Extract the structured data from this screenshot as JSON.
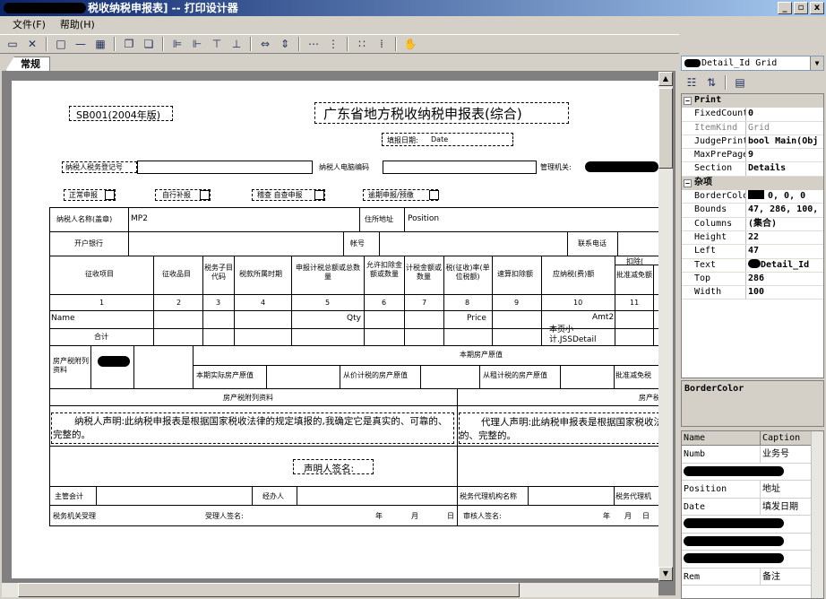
{
  "window": {
    "title_suffix": "税收纳税申报表] -- 打印设计器",
    "buttons": [
      "_",
      "▫",
      "x"
    ]
  },
  "menu": [
    "文件(F)",
    "帮助(H)"
  ],
  "tab": "常规",
  "report": {
    "code": "SB001(2004年版)",
    "title": "广东省地方税收纳税申报表(综合)",
    "fill_date_label": "填报日期:",
    "fill_date_field": "Date",
    "taxpayer_reg_label": "纳税人税务登记号",
    "taxpayer_pc_label": "纳税人电脑编码",
    "authority_label": "管理机关:",
    "check_normal": "正常申报",
    "check_self": "自行补报",
    "check_inspect": "稽查 自查申报",
    "check_late": "逾期申报/预缴",
    "name_label": "纳税人名称(盖章)",
    "name_field": "MP2",
    "address_label": "住所地址",
    "address_field": "Position",
    "bank_label": "开户银行",
    "account_label": "帐号",
    "phone_label": "联系电话",
    "col_headers": [
      "征收项目",
      "征收品目",
      "税务子目代码",
      "税款所属时期",
      "申报计税总额或总数量",
      "允许扣除金额或数量",
      "计税金额或数量",
      "税(征收)率(单位税额)",
      "速算扣除额",
      "应纳税(费)额",
      "扣除(",
      "批准减免额"
    ],
    "col_numbers": [
      "1",
      "2",
      "3",
      "4",
      "5",
      "6",
      "7",
      "8",
      "9",
      "10",
      "11"
    ],
    "detail_row": {
      "name": "Name",
      "qty": "Qty",
      "price": "Price",
      "amt": "Amt2"
    },
    "total_label": "合计",
    "page_subtotal": "本页小计.JSSDetail",
    "property_label": "房产税附列资料",
    "property_original": "本期房产原值",
    "property_actual": "本期实际房产原值",
    "property_price": "从价计税的房产原值",
    "property_rent": "从租计税的房产原值",
    "property_exempt": "批准减免税",
    "property_attach": "房产税附列资料",
    "property_attach2": "房产税",
    "declaration": "纳税人声明:此纳税申报表是根据国家税收法律的规定填报的,我确定它是真实的、可靠的、完整的。",
    "agent_declaration": "代理人声明:此纳税申报表是根据国家税收法",
    "agent_decl2": "的、完整的。",
    "signature_label": "声明人签名:",
    "accountant_label": "主管会计",
    "handler_label": "经办人",
    "agent_org_label": "税务代理机构名称",
    "agent_org2": "税务代理机",
    "received_by": "税务机关受理",
    "receiver_sign": "受理人签名:",
    "year": "年",
    "month": "月",
    "day": "日",
    "reviewer_sign": "审核人签名:"
  },
  "properties": {
    "object": "Detail_Id Grid",
    "rows": [
      {
        "type": "cat",
        "label": "Print"
      },
      {
        "key": "FixedCount",
        "value": "0"
      },
      {
        "key": "ItemKind",
        "value": "Grid",
        "disabled": true
      },
      {
        "key": "JudgePrint",
        "value": "bool Main(Obj"
      },
      {
        "key": "MaxPrePage",
        "value": "9"
      },
      {
        "key": "Section",
        "value": "Details"
      },
      {
        "type": "cat",
        "label": "杂项"
      },
      {
        "key": "BorderColo",
        "value": "0, 0, 0"
      },
      {
        "key": "Bounds",
        "value": "47, 286, 100,"
      },
      {
        "key": "Columns",
        "value": "(集合)"
      },
      {
        "key": "Height",
        "value": "22"
      },
      {
        "key": "Left",
        "value": "47"
      },
      {
        "key": "Text",
        "value": "Detail_Id"
      },
      {
        "key": "Top",
        "value": "286"
      },
      {
        "key": "Width",
        "value": "100"
      }
    ],
    "description": "BorderColor"
  },
  "fields": {
    "headers": [
      "Name",
      "Caption"
    ],
    "rows": [
      {
        "name": "Numb",
        "caption": "业务号"
      },
      {
        "name": "",
        "caption": "",
        "redacted": true
      },
      {
        "name": "Position",
        "caption": "地址"
      },
      {
        "name": "Date",
        "caption": "填发日期"
      },
      {
        "name": "",
        "caption": "",
        "redacted": true
      },
      {
        "name": "",
        "caption": "",
        "redacted": true
      },
      {
        "name": "",
        "caption": "",
        "redacted": true
      },
      {
        "name": "Rem",
        "caption": "备注"
      }
    ]
  }
}
